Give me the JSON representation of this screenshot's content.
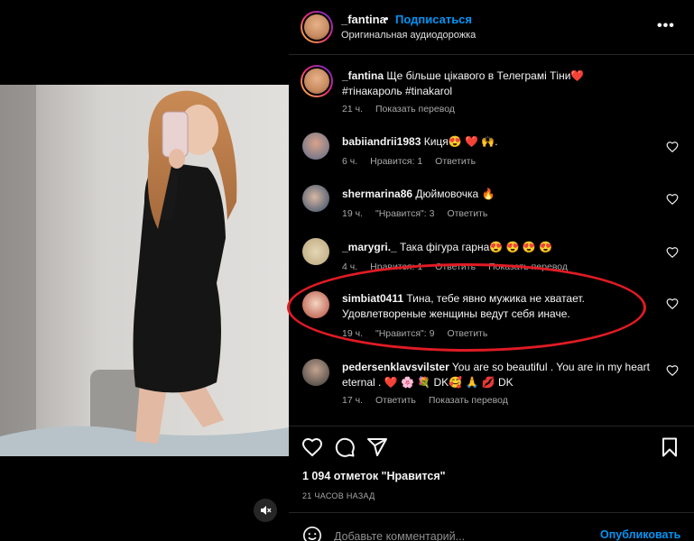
{
  "header": {
    "username": "_fantina",
    "dot": "•",
    "follow_label": "Подписаться",
    "audio_label": "Оригинальная аудиодорожка",
    "more_label": "•••"
  },
  "caption": {
    "username": "_fantina",
    "text": " Ще більше цікавого в Телеграмі Тіни❤️",
    "hashtags": "#тінакароль #tinakarol",
    "time": "21 ч.",
    "translate": "Показать перевод"
  },
  "comments": [
    {
      "username": "babiiandrii1983",
      "text": " Киця😍 ❤️ 🙌.",
      "time": "6 ч.",
      "likes": "Нравится: 1",
      "reply": "Ответить",
      "translate": ""
    },
    {
      "username": "shermarina86",
      "text": " Дюймовочка 🔥",
      "time": "19 ч.",
      "likes": "\"Нравится\": 3",
      "reply": "Ответить",
      "translate": ""
    },
    {
      "username": "_marygri._",
      "text": " Така фігура гарна😍 😍 😍 😍",
      "time": "4 ч.",
      "likes": "Нравится: 1",
      "reply": "Ответить",
      "translate": "Показать перевод"
    },
    {
      "username": "simbiat0411",
      "text": " Тина, тебе явно мужика не хватает. Удовлетвореные женщины ведут себя иначе.",
      "time": "19 ч.",
      "likes": "\"Нравится\": 9",
      "reply": "Ответить",
      "translate": ""
    },
    {
      "username": "pedersenklavsvilster",
      "text": " You are so beautiful . You are in my heart eternal . ❤️ 🌸 💐 DK🥰 🙏 💋 DK",
      "time": "17 ч.",
      "likes": "",
      "reply": "Ответить",
      "translate": "Показать перевод"
    }
  ],
  "footer": {
    "likes_count": "1 094 отметок \"Нравится\"",
    "time_ago": "21 ЧАСОВ НАЗАД",
    "add_comment_placeholder": "Добавьте комментарий...",
    "publish_label": "Опубликовать"
  },
  "colors": {
    "accent": "#0095f6",
    "highlight_oval": "#e01b24",
    "heart_red": "#ff3040"
  }
}
